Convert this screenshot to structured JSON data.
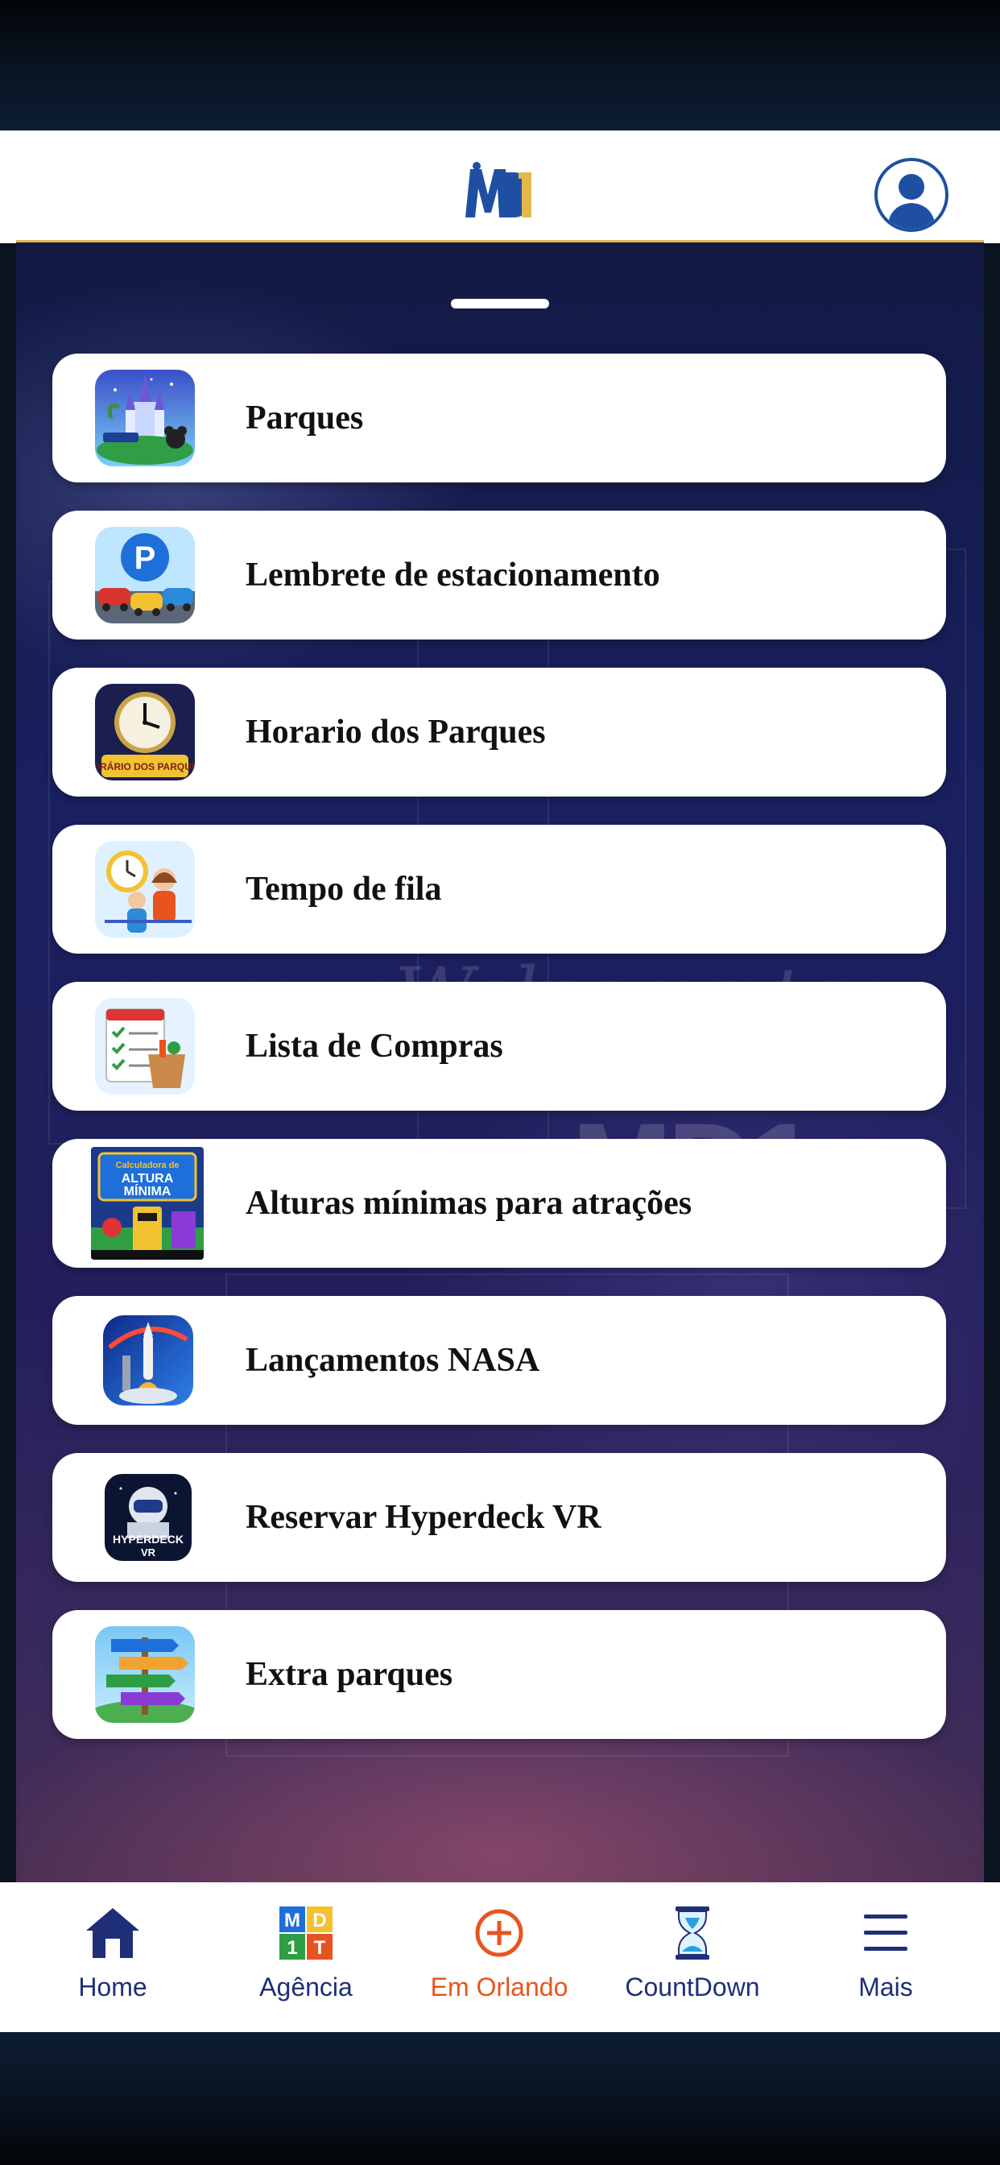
{
  "app": {
    "logo_text": "MD1"
  },
  "menu": {
    "items": [
      {
        "label": "Parques",
        "icon": "parks-castle-icon"
      },
      {
        "label": "Lembrete de estacionamento",
        "icon": "parking-icon"
      },
      {
        "label": "Horario dos Parques",
        "icon": "park-hours-clock-icon",
        "icon_text": "HORÁRIO DOS PARQUES"
      },
      {
        "label": "Tempo de fila",
        "icon": "queue-time-icon"
      },
      {
        "label": "Lista de Compras",
        "icon": "shopping-list-icon"
      },
      {
        "label": "Alturas mínimas para atrações",
        "icon": "min-height-calculator-icon",
        "icon_text": "Calculadora de ALTURA MÍNIMA das Atrações"
      },
      {
        "label": "Lançamentos NASA",
        "icon": "rocket-launch-icon"
      },
      {
        "label": "Reservar Hyperdeck VR",
        "icon": "hyperdeck-vr-icon",
        "icon_text": "HYPERDECK VR"
      },
      {
        "label": "Extra parques",
        "icon": "extra-parks-signpost-icon"
      }
    ]
  },
  "nav": {
    "items": [
      {
        "label": "Home",
        "icon": "home-icon",
        "active": false
      },
      {
        "label": "Agência",
        "icon": "agency-md1t-icon",
        "icon_text": "MD1T",
        "active": false
      },
      {
        "label": "Em Orlando",
        "icon": "plus-circle-icon",
        "active": true
      },
      {
        "label": "CountDown",
        "icon": "hourglass-icon",
        "active": false
      },
      {
        "label": "Mais",
        "icon": "menu-hamburger-icon",
        "active": false
      }
    ]
  },
  "colors": {
    "nav_text": "#1e2f78",
    "nav_active": "#e8541f",
    "header_accent": "#e2b84d",
    "brand_blue": "#1f4fa3"
  }
}
